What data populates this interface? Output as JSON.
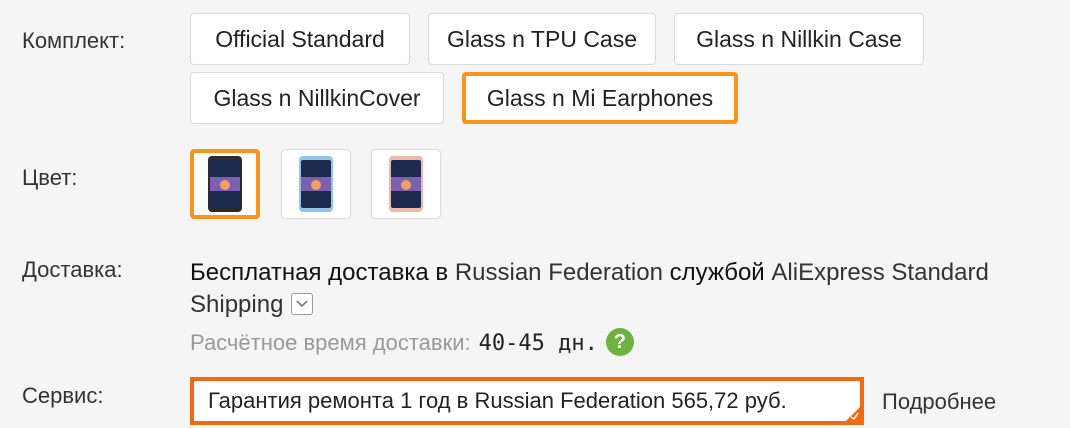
{
  "labels": {
    "kit": "Комплект:",
    "color": "Цвет:",
    "delivery": "Доставка:",
    "service": "Сервис:"
  },
  "kit_options": [
    {
      "label": "Official Standard",
      "selected": false
    },
    {
      "label": "Glass n TPU Case",
      "selected": false
    },
    {
      "label": "Glass n Nillkin Case",
      "selected": false
    },
    {
      "label": "Glass n NillkinCover",
      "selected": false
    },
    {
      "label": "Glass n Mi Earphones",
      "selected": true
    }
  ],
  "color_options": [
    {
      "name": "black-phone-icon",
      "color": "#2b2b2b",
      "selected": true
    },
    {
      "name": "blue-phone-icon",
      "color": "#8ec5e8",
      "selected": false
    },
    {
      "name": "pink-phone-icon",
      "color": "#f0b7a8",
      "selected": false
    }
  ],
  "shipping": {
    "lead": "Бесплатная доставка в",
    "country": "Russian Federation",
    "by": "службой",
    "method": "AliExpress Standard Shipping",
    "estimate_label": "Расчётное время доставки:",
    "estimate_days": "40-45 дн.",
    "help_icon": "?"
  },
  "service": {
    "text": "Гарантия ремонта 1 год в Russian Federation 565,72 руб.",
    "more_link": "Подробнее"
  },
  "colors": {
    "accent": "#f7941d",
    "service_border": "#ef6a10",
    "help_green": "#6db33f"
  }
}
